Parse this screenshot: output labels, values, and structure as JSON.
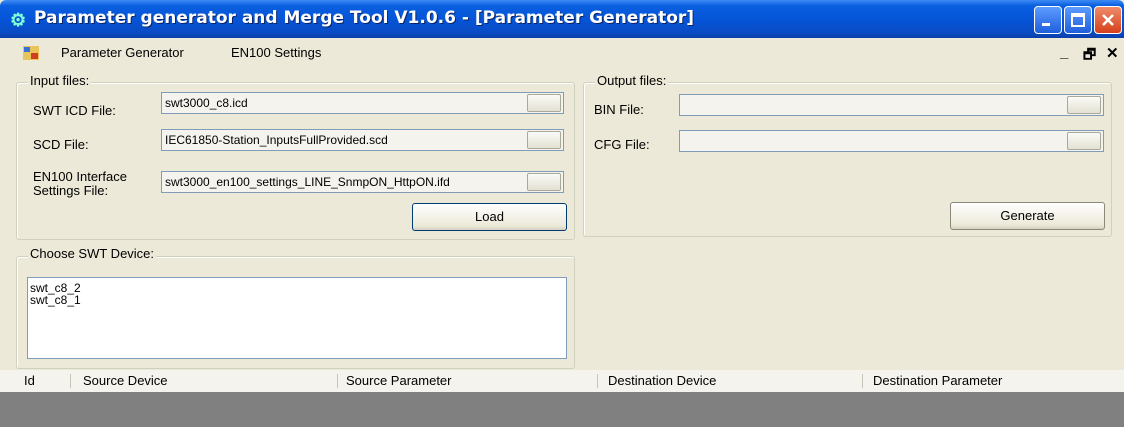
{
  "window": {
    "title": "Parameter generator and Merge Tool V1.0.6 - [Parameter Generator]",
    "icon": "app-icon"
  },
  "menu": {
    "items": [
      "Parameter Generator",
      "EN100 Settings"
    ],
    "mdi_minimize": "_",
    "mdi_restore": "🗗",
    "mdi_close": "✕"
  },
  "input_files": {
    "legend": "Input files:",
    "swt_icd_label": "SWT ICD File:",
    "swt_icd_value": "swt3000_c8.icd",
    "scd_label": "SCD File:",
    "scd_value": "IEC61850-Station_InputsFullProvided.scd",
    "en100_label_line1": "EN100 Interface",
    "en100_label_line2": "Settings File:",
    "en100_value": "swt3000_en100_settings_LINE_SnmpON_HttpON.ifd",
    "load_label": "Load"
  },
  "output_files": {
    "legend": "Output files:",
    "bin_label": "BIN File:",
    "bin_value": "",
    "cfg_label": "CFG File:",
    "cfg_value": "",
    "generate_label": "Generate"
  },
  "device": {
    "legend": "Choose SWT Device:",
    "items": [
      "swt_c8_2",
      "swt_c8_1"
    ]
  },
  "table": {
    "columns": [
      "Id",
      "Source Device",
      "Source Parameter",
      "Destination Device",
      "Destination Parameter"
    ]
  }
}
